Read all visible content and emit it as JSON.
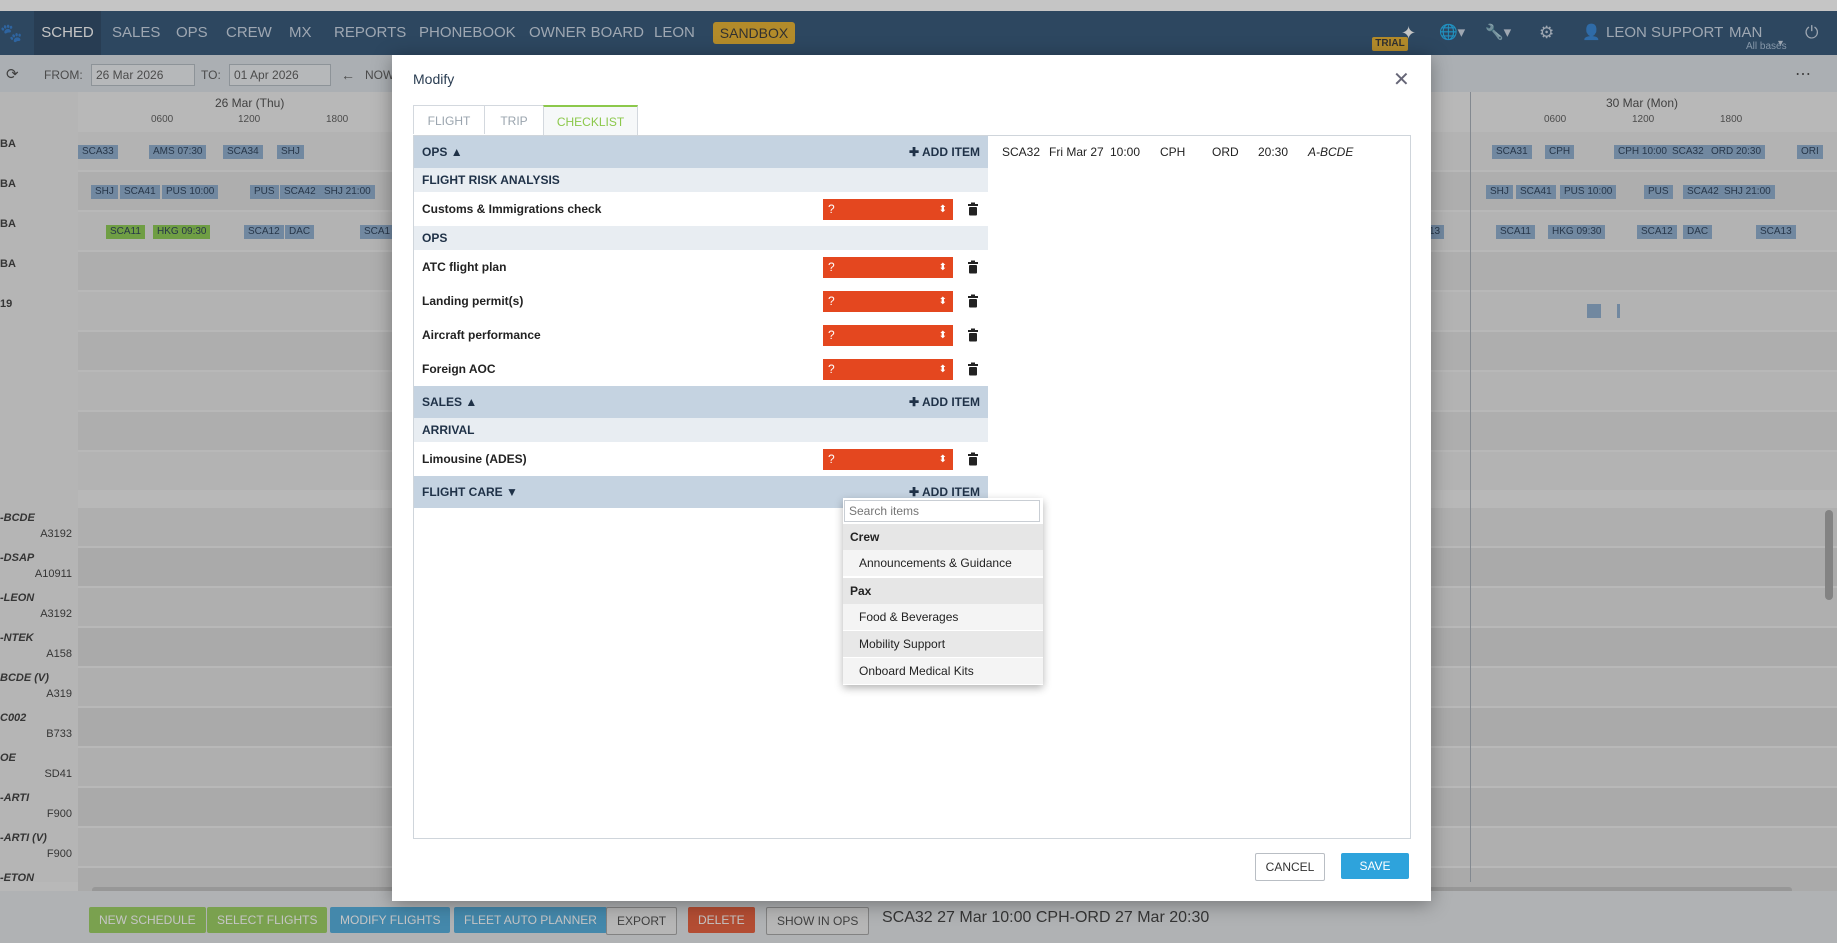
{
  "nav": {
    "logo_icon": "paw-icon",
    "items": [
      "SCHED",
      "SALES",
      "OPS",
      "CREW",
      "MX",
      "REPORTS",
      "PHONEBOOK",
      "OWNER BOARD",
      "LEON"
    ],
    "sandbox": "SANDBOX",
    "trial": "TRIAL",
    "user": "LEON SUPPORT",
    "base": "MAN",
    "base_sub": "All bases"
  },
  "toolbar": {
    "from_label": "FROM:",
    "from_value": "26 Mar 2026",
    "to_label": "TO:",
    "to_value": "01 Apr 2026",
    "now": "NOW"
  },
  "schedule": {
    "day_left": "26 Mar (Thu)",
    "day_right": "30 Mar (Mon)",
    "hours": [
      "0600",
      "1200",
      "1800"
    ],
    "row_labels_top": [
      "BA",
      "BA",
      "BA",
      "BA",
      "19"
    ],
    "aircraft": [
      {
        "reg": "-BCDE",
        "type": "A3192"
      },
      {
        "reg": "-DSAP",
        "type": "A10911"
      },
      {
        "reg": "-LEON",
        "type": "A3192"
      },
      {
        "reg": "-NTEK",
        "type": "A158"
      },
      {
        "reg": "BCDE (V)",
        "type": "A319"
      },
      {
        "reg": "C002",
        "type": "B733"
      },
      {
        "reg": "OE",
        "type": "SD41"
      },
      {
        "reg": "-ARTI",
        "type": "F900"
      },
      {
        "reg": "-ARTI (V)",
        "type": "F900"
      },
      {
        "reg": "-ETON",
        "type": ""
      }
    ],
    "left_blocks": [
      [
        "SCA33",
        "AMS 07:30",
        "SCA34",
        "SHJ"
      ],
      [
        "SHJ",
        "SCA41",
        "PUS 10:00",
        "PUS",
        "SCA42",
        "SHJ 21:00"
      ],
      [
        "SCA11",
        "HKG 09:30",
        "SCA12",
        "DAC",
        "SCA1"
      ]
    ],
    "right_blocks": [
      [
        "SCA31",
        "CPH",
        "CPH 10:00",
        "SCA32",
        "ORD 20:30",
        "ORI"
      ],
      [
        "SHJ",
        "SCA41",
        "PUS 10:00",
        "PUS",
        "SCA42",
        "SHJ 21:00"
      ],
      [
        "13",
        "SCA11",
        "HKG 09:30",
        "SCA12",
        "DAC",
        "SCA13"
      ]
    ]
  },
  "bottom": {
    "buttons": [
      {
        "label": "NEW SCHEDULE",
        "color": "#8cc84b"
      },
      {
        "label": "SELECT FLIGHTS",
        "color": "#8cc84b"
      },
      {
        "label": "MODIFY FLIGHTS",
        "color": "#3aa1d8"
      },
      {
        "label": "FLEET AUTO PLANNER",
        "color": "#3aa1d8"
      },
      {
        "label": "EXPORT",
        "color": "#e9e9e9"
      },
      {
        "label": "DELETE",
        "color": "#e4471f"
      },
      {
        "label": "SHOW IN OPS",
        "color": "#e9e9e9"
      }
    ],
    "selection": "SCA32 27 Mar 10:00 CPH-ORD 27 Mar 20:30"
  },
  "modal": {
    "title": "Modify",
    "tabs": [
      "FLIGHT",
      "TRIP",
      "CHECKLIST"
    ],
    "active_tab": "CHECKLIST",
    "add_item": "ADD ITEM",
    "sections": [
      {
        "name": "OPS",
        "collapsed": false
      },
      {
        "name": "SALES",
        "collapsed": false
      },
      {
        "name": "FLIGHT CARE",
        "collapsed": true
      }
    ],
    "subheads": [
      "FLIGHT RISK ANALYSIS",
      "OPS",
      "ARRIVAL"
    ],
    "items": [
      {
        "label": "Customs & Immigrations check",
        "status": "?"
      },
      {
        "label": "ATC flight plan",
        "status": "?"
      },
      {
        "label": "Landing permit(s)",
        "status": "?"
      },
      {
        "label": "Aircraft performance",
        "status": "?"
      },
      {
        "label": "Foreign AOC",
        "status": "?"
      },
      {
        "label": "Limousine (ADES)",
        "status": "?"
      }
    ],
    "flight": {
      "number": "SCA32",
      "date": "Fri Mar 27",
      "dep_time": "10:00",
      "from": "CPH",
      "to": "ORD",
      "arr_time": "20:30",
      "reg": "A-BCDE"
    },
    "dropdown": {
      "search_placeholder": "Search items",
      "groups": [
        {
          "name": "Crew",
          "options": [
            "Announcements & Guidance"
          ]
        },
        {
          "name": "Pax",
          "options": [
            "Food & Beverages",
            "Mobility Support",
            "Onboard Medical Kits"
          ]
        }
      ]
    },
    "cancel": "CANCEL",
    "save": "SAVE"
  }
}
